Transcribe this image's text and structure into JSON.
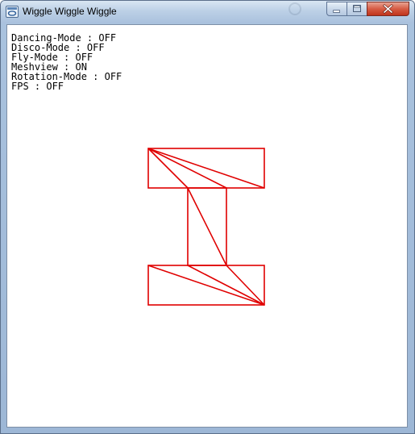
{
  "window": {
    "title": "Wiggle Wiggle Wiggle",
    "app_icon": "window-app-icon",
    "controls": [
      {
        "name": "minimize-button",
        "icon": "minimize-icon"
      },
      {
        "name": "maximize-button",
        "icon": "maximize-icon"
      },
      {
        "name": "close-button",
        "icon": "close-icon"
      }
    ]
  },
  "status": {
    "lines": [
      {
        "label": "Dancing-Mode",
        "value": "OFF",
        "text": "Dancing-Mode : OFF"
      },
      {
        "label": "Disco-Mode",
        "value": "OFF",
        "text": "Disco-Mode : OFF"
      },
      {
        "label": "Fly-Mode",
        "value": "OFF",
        "text": "Fly-Mode : OFF"
      },
      {
        "label": "Meshview",
        "value": "ON",
        "text": "Meshview : ON"
      },
      {
        "label": "Rotation-Mode",
        "value": "OFF",
        "text": "Rotation-Mode : OFF"
      },
      {
        "label": "FPS",
        "value": "OFF",
        "text": "FPS : OFF"
      }
    ]
  },
  "scene": {
    "description_shape": "I-beam wireframe mesh",
    "stroke_color": "#e00000",
    "background_color": "#ffffff"
  },
  "colors": {
    "titlebar": "#bcd0e6",
    "close_button": "#d65c44",
    "mesh_line": "#e00000"
  }
}
